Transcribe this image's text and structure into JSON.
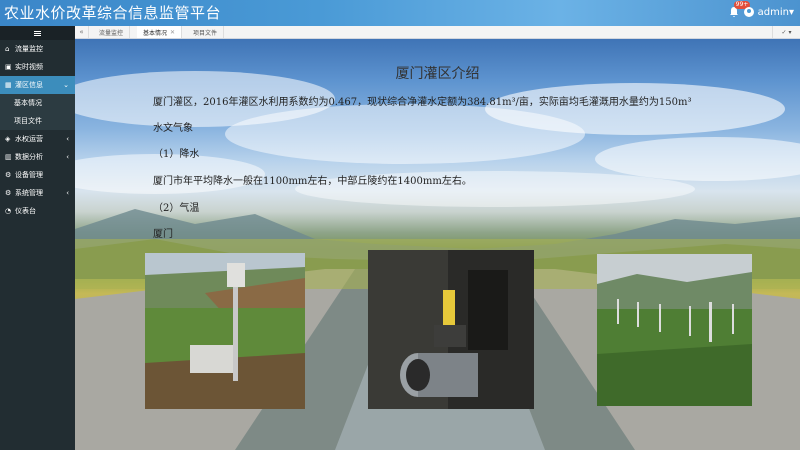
{
  "header": {
    "title": "农业水价改革综合信息监管平台",
    "notification_count": "99+",
    "user_label": "admin"
  },
  "sidebar": {
    "items": [
      {
        "label": "流量监控",
        "icon": "home-icon"
      },
      {
        "label": "实时视频",
        "icon": "video-icon"
      },
      {
        "label": "灌区信息",
        "icon": "grid-icon",
        "active": true
      },
      {
        "label": "基本情况",
        "sub": true
      },
      {
        "label": "项目文件",
        "sub": true
      },
      {
        "label": "水权运营",
        "icon": "tag-icon"
      },
      {
        "label": "数据分析",
        "icon": "chart-icon"
      },
      {
        "label": "设备管理",
        "icon": "gear-icon"
      },
      {
        "label": "系统管理",
        "icon": "gears-icon"
      },
      {
        "label": "仪表台",
        "icon": "dashboard-icon"
      }
    ]
  },
  "tabs": [
    {
      "label": "流量监控"
    },
    {
      "label": "基本情况",
      "active": true
    },
    {
      "label": "项目文件"
    }
  ],
  "tab_right_label": "✓",
  "content": {
    "title": "厦门灌区介绍",
    "line1": "厦门灌区，2016年灌区水利用系数约为0.467，现状综合净灌水定额为384.81m³/亩，实际亩均毛灌溉用水量约为150m³",
    "line2": "水文气象",
    "line3": "（1）降水",
    "line4": "厦门市年平均降水一般在1100mm左右，中部丘陵约在1400mm左右。",
    "line5": "（2）气温",
    "line6": "厦门"
  },
  "colors": {
    "header_bg": "#4a9ad6",
    "sidebar_bg": "#222d32",
    "active_item": "#3c8dbc"
  }
}
